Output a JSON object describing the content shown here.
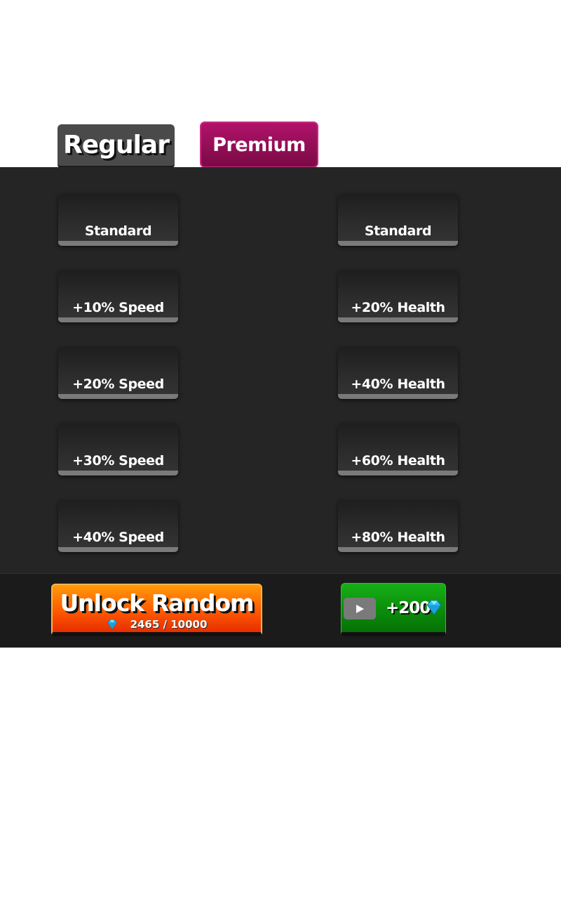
{
  "tabs": {
    "regular": "Regular",
    "premium": "Premium"
  },
  "upgrades": {
    "speed": [
      "Standard",
      "+10% Speed",
      "+20% Speed",
      "+30% Speed",
      "+40% Speed"
    ],
    "health": [
      "Standard",
      "+20% Health",
      "+40% Health",
      "+60% Health",
      "+80% Health"
    ]
  },
  "unlock": {
    "label": "Unlock Random",
    "progress": "2465 / 10000",
    "current_gems": 2465,
    "required_gems": 10000
  },
  "reward": {
    "label": "+200",
    "amount": 200
  },
  "icons": {
    "gem": "gem-icon",
    "play": "play-icon"
  },
  "colors": {
    "regular_tab": "#4a4a4a",
    "premium_tab": "#9e0f5c",
    "panel": "#252525",
    "unlock_button": "#ff5a00",
    "reward_button": "#0a8a0a"
  }
}
